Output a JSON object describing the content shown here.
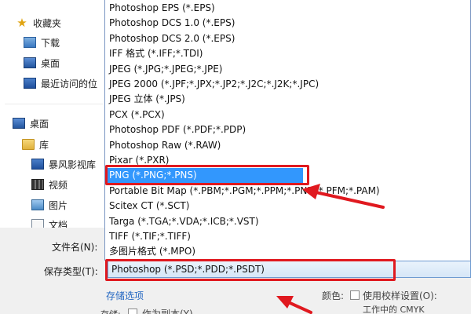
{
  "nav": {
    "items": [
      {
        "label": "收藏夹",
        "icon": "star-icon"
      },
      {
        "label": "下载",
        "icon": "download-folder-icon"
      },
      {
        "label": "桌面",
        "icon": "desktop-icon"
      },
      {
        "label": "最近访问的位",
        "icon": "recent-places-icon"
      },
      {
        "label": "桌面",
        "icon": "desktop-icon"
      },
      {
        "label": "库",
        "icon": "library-folder-icon"
      },
      {
        "label": "暴风影视库",
        "icon": "video-library-icon"
      },
      {
        "label": "视频",
        "icon": "video-icon"
      },
      {
        "label": "图片",
        "icon": "pictures-icon"
      },
      {
        "label": "文档",
        "icon": "documents-icon"
      }
    ]
  },
  "dropdown": {
    "options": [
      "Photoshop EPS (*.EPS)",
      "Photoshop DCS 1.0 (*.EPS)",
      "Photoshop DCS 2.0 (*.EPS)",
      "IFF 格式 (*.IFF;*.TDI)",
      "JPEG (*.JPG;*.JPEG;*.JPE)",
      "JPEG 2000 (*.JPF;*.JPX;*.JP2;*.J2C;*.J2K;*.JPC)",
      "JPEG 立体 (*.JPS)",
      "PCX (*.PCX)",
      "Photoshop PDF (*.PDF;*.PDP)",
      "Photoshop Raw (*.RAW)",
      "Pixar (*.PXR)",
      "PNG (*.PNG;*.PNS)",
      "Portable Bit Map (*.PBM;*.PGM;*.PPM;*.PNM;*.PFM;*.PAM)",
      "Scitex CT (*.SCT)",
      "Targa (*.TGA;*.VDA;*.ICB;*.VST)",
      "TIFF (*.TIF;*.TIFF)",
      "多图片格式 (*.MPO)"
    ],
    "selected_index": 11
  },
  "form": {
    "filename_label": "文件名(N):",
    "savetype_label": "保存类型(T):",
    "savetype_value": "Photoshop (*.PSD;*.PDD;*.PSDT)",
    "save_options_label": "存储选项",
    "color_label": "颜色:",
    "proof_setup_label": "使用校样设置(O):",
    "proof_setup_value": "工作中的 CMYK",
    "store_label": "存储:",
    "as_copy_label": "作为副本(Y)"
  },
  "colors": {
    "selection": "#3297fd",
    "annotation": "#e0191f",
    "link": "#2467c2"
  }
}
